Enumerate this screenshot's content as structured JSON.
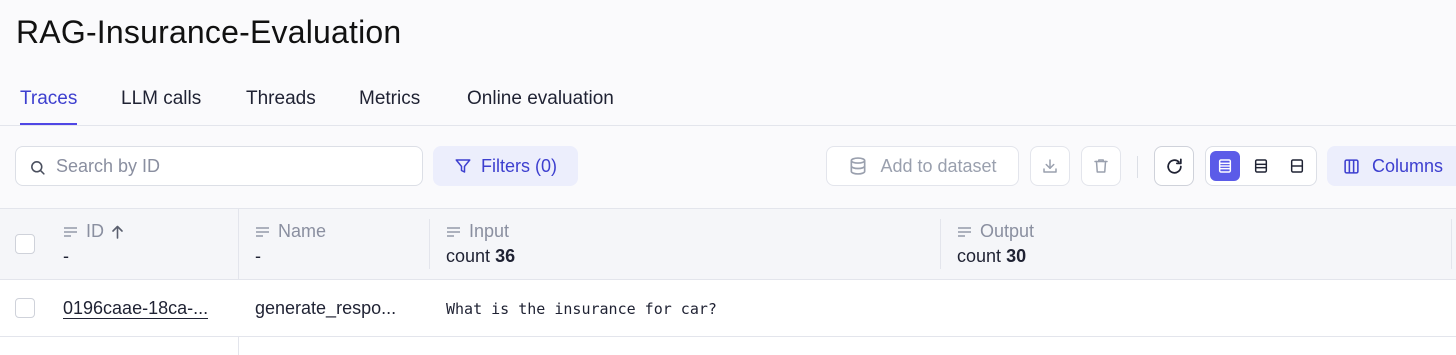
{
  "page": {
    "title": "RAG-Insurance-Evaluation"
  },
  "tabs": [
    {
      "label": "Traces",
      "active": true
    },
    {
      "label": "LLM calls",
      "active": false
    },
    {
      "label": "Threads",
      "active": false
    },
    {
      "label": "Metrics",
      "active": false
    },
    {
      "label": "Online evaluation",
      "active": false
    }
  ],
  "toolbar": {
    "search_placeholder": "Search by ID",
    "search_value": "",
    "filters_label": "Filters (0)",
    "add_to_dataset_label": "Add to dataset",
    "columns_label": "Columns",
    "icons": [
      "search-icon",
      "filter-icon",
      "database-icon",
      "download-icon",
      "trash-icon",
      "refresh-icon",
      "density-compact-icon",
      "density-medium-icon",
      "density-large-icon",
      "columns-icon"
    ]
  },
  "table": {
    "columns": [
      {
        "label": "ID",
        "sort": "asc",
        "sub": "-"
      },
      {
        "label": "Name",
        "sub": "-"
      },
      {
        "label": "Input",
        "sub_prefix": "count",
        "sub_value": "36"
      },
      {
        "label": "Output",
        "sub_prefix": "count",
        "sub_value": "30"
      }
    ],
    "rows": [
      {
        "id": "0196caae-18ca-...",
        "name": "generate_respo...",
        "input": "What is the insurance for car?",
        "output": ""
      }
    ]
  },
  "colors": {
    "accent": "#4f46e5",
    "accent_bg": "#eceefc",
    "muted": "#8a8fa0"
  }
}
